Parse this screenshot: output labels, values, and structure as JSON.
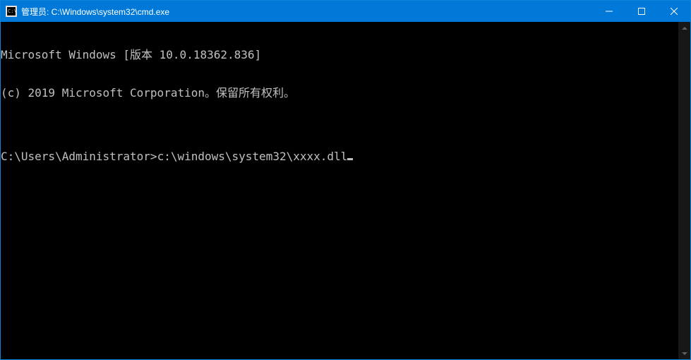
{
  "titlebar": {
    "icon_text": "C:\\.",
    "title": "管理员: C:\\Windows\\system32\\cmd.exe"
  },
  "console": {
    "line1": "Microsoft Windows [版本 10.0.18362.836]",
    "line2": "(c) 2019 Microsoft Corporation。保留所有权利。",
    "blank": "",
    "prompt": "C:\\Users\\Administrator>",
    "input": "c:\\windows\\system32\\xxxx.dll"
  }
}
